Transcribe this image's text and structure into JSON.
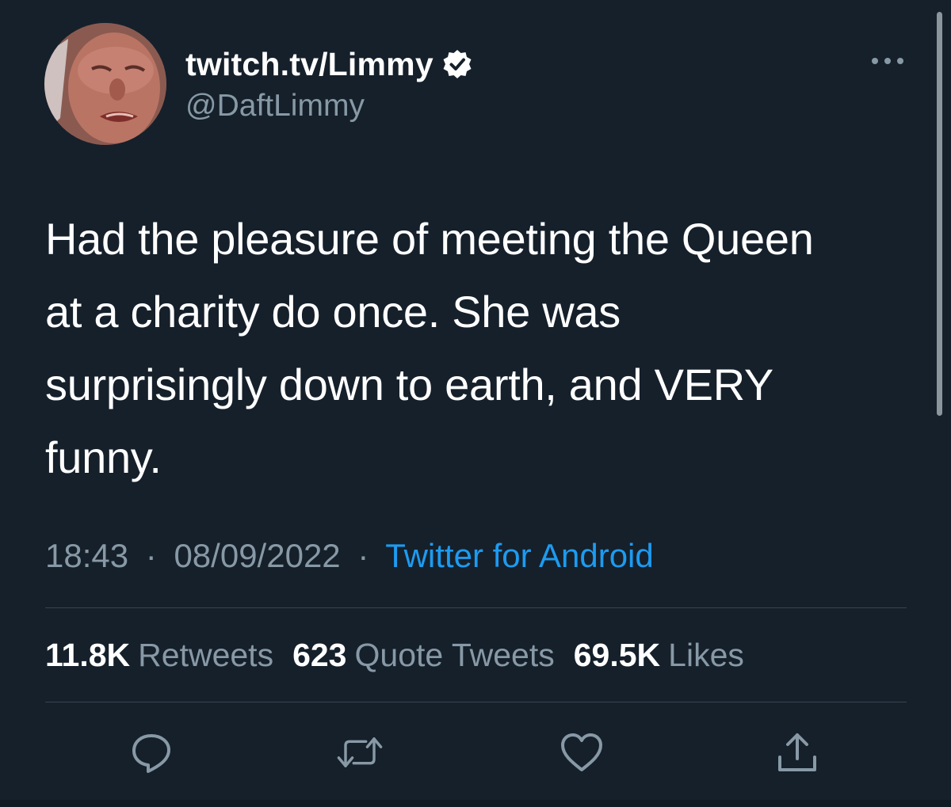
{
  "tweet": {
    "author": {
      "display_name": "twitch.tv/Limmy",
      "handle": "@DaftLimmy",
      "verified": true
    },
    "text": "Had the pleasure of meeting the Queen\nat a charity do once. She was\nsurprisingly down to earth, and VERY\nfunny.",
    "time": "18:43",
    "date": "08/09/2022",
    "separator": "·",
    "source": "Twitter for Android",
    "stats": {
      "retweets_count": "11.8K",
      "retweets_label": "Retweets",
      "quotes_count": "623",
      "quotes_label": "Quote Tweets",
      "likes_count": "69.5K",
      "likes_label": "Likes"
    },
    "actions": {
      "reply_icon": "reply-icon",
      "retweet_icon": "retweet-icon",
      "like_icon": "heart-icon",
      "share_icon": "share-icon"
    },
    "more_icon": "more-icon"
  },
  "colors": {
    "background": "#15202b",
    "primary_text": "#ffffff",
    "secondary_text": "#8899a6",
    "link": "#1d9bf0",
    "divider": "#38444d"
  }
}
